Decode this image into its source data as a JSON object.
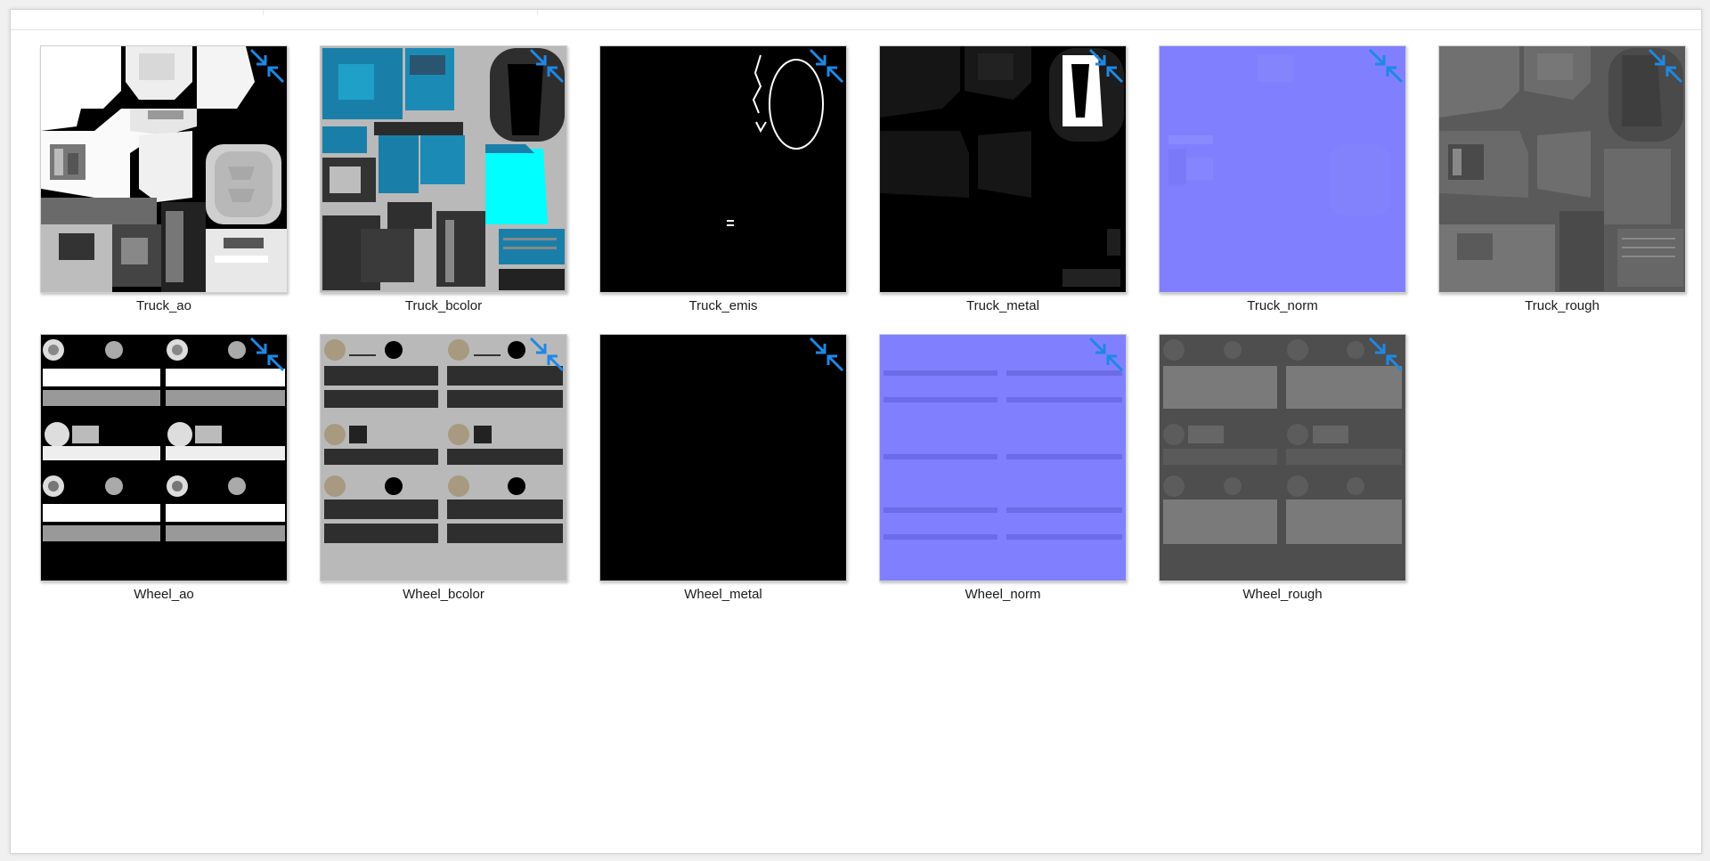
{
  "colors": {
    "accent_blue": "#1e88e5",
    "normal_map_blue": "#8080ff",
    "albedo_teal": "#1fa0c8",
    "albedo_cyan": "#00ffff",
    "rough_gray": "#5a5a5a",
    "bcolor_bg": "#b9b9b9"
  },
  "files": [
    {
      "name": "Truck_ao",
      "kind": "ao",
      "icon": "compressed-arrows-icon"
    },
    {
      "name": "Truck_bcolor",
      "kind": "truck-bcolor",
      "icon": "compressed-arrows-icon"
    },
    {
      "name": "Truck_emis",
      "kind": "emis",
      "icon": "compressed-arrows-icon"
    },
    {
      "name": "Truck_metal",
      "kind": "truck-metal",
      "icon": "compressed-arrows-icon"
    },
    {
      "name": "Truck_norm",
      "kind": "truck-norm",
      "icon": "compressed-arrows-icon"
    },
    {
      "name": "Truck_rough",
      "kind": "truck-rough",
      "icon": "compressed-arrows-icon"
    },
    {
      "name": "Wheel_ao",
      "kind": "wheel-ao",
      "icon": "compressed-arrows-icon"
    },
    {
      "name": "Wheel_bcolor",
      "kind": "wheel-bcolor",
      "icon": "compressed-arrows-icon"
    },
    {
      "name": "Wheel_metal",
      "kind": "wheel-metal",
      "icon": "compressed-arrows-icon"
    },
    {
      "name": "Wheel_norm",
      "kind": "wheel-norm",
      "icon": "compressed-arrows-icon"
    },
    {
      "name": "Wheel_rough",
      "kind": "wheel-rough",
      "icon": "compressed-arrows-icon"
    }
  ]
}
